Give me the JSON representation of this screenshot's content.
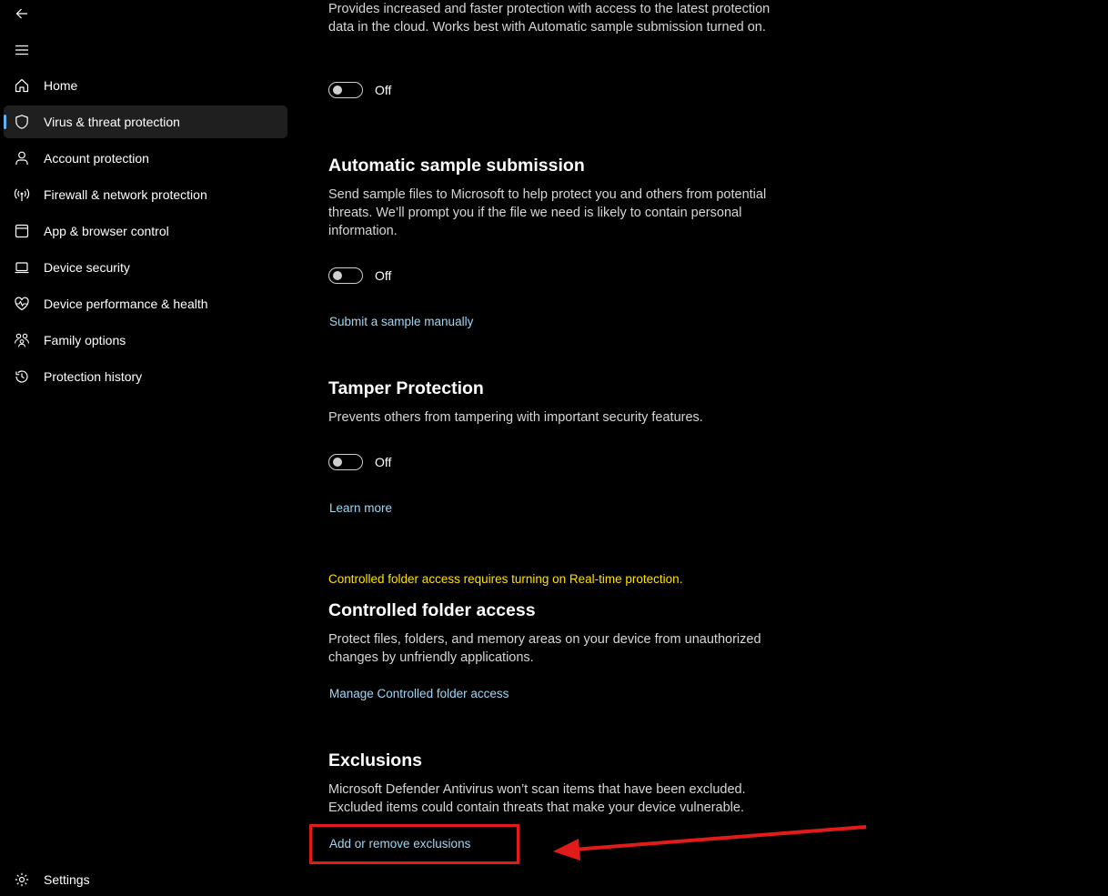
{
  "sidebar": {
    "back_icon": "back-arrow-icon",
    "menu_icon": "hamburger-menu-icon",
    "items": [
      {
        "label": "Home",
        "icon": "home-icon",
        "active": false
      },
      {
        "label": "Virus & threat protection",
        "icon": "shield-icon",
        "active": true
      },
      {
        "label": "Account protection",
        "icon": "person-icon",
        "active": false
      },
      {
        "label": "Firewall & network protection",
        "icon": "wifi-antenna-icon",
        "active": false
      },
      {
        "label": "App & browser control",
        "icon": "browser-window-icon",
        "active": false
      },
      {
        "label": "Device security",
        "icon": "laptop-icon",
        "active": false
      },
      {
        "label": "Device performance & health",
        "icon": "heart-pulse-icon",
        "active": false
      },
      {
        "label": "Family options",
        "icon": "family-icon",
        "active": false
      },
      {
        "label": "Protection history",
        "icon": "history-icon",
        "active": false
      }
    ],
    "settings": {
      "label": "Settings",
      "icon": "gear-icon"
    }
  },
  "cloud_protection": {
    "description": "Provides increased and faster protection with access to the latest protection data in the cloud. Works best with Automatic sample submission turned on.",
    "toggle_state": "Off"
  },
  "sample_submission": {
    "title": "Automatic sample submission",
    "description": "Send sample files to Microsoft to help protect you and others from potential threats. We’ll prompt you if the file we need is likely to contain personal information.",
    "toggle_state": "Off",
    "link": "Submit a sample manually"
  },
  "tamper_protection": {
    "title": "Tamper Protection",
    "description": "Prevents others from tampering with important security features.",
    "toggle_state": "Off",
    "link": "Learn more"
  },
  "controlled_folder": {
    "warning": "Controlled folder access requires turning on Real-time protection.",
    "title": "Controlled folder access",
    "description": "Protect files, folders, and memory areas on your device from unauthorized changes by unfriendly applications.",
    "link": "Manage Controlled folder access"
  },
  "exclusions": {
    "title": "Exclusions",
    "description": "Microsoft Defender Antivirus won’t scan items that have been excluded. Excluded items could contain threats that make your device vulnerable.",
    "link": "Add or remove exclusions"
  },
  "annotation": {
    "color": "#e11a1a"
  },
  "colors": {
    "accent": "#5fb2f2",
    "link": "#9fd6f5",
    "warning": "#ffe100"
  }
}
